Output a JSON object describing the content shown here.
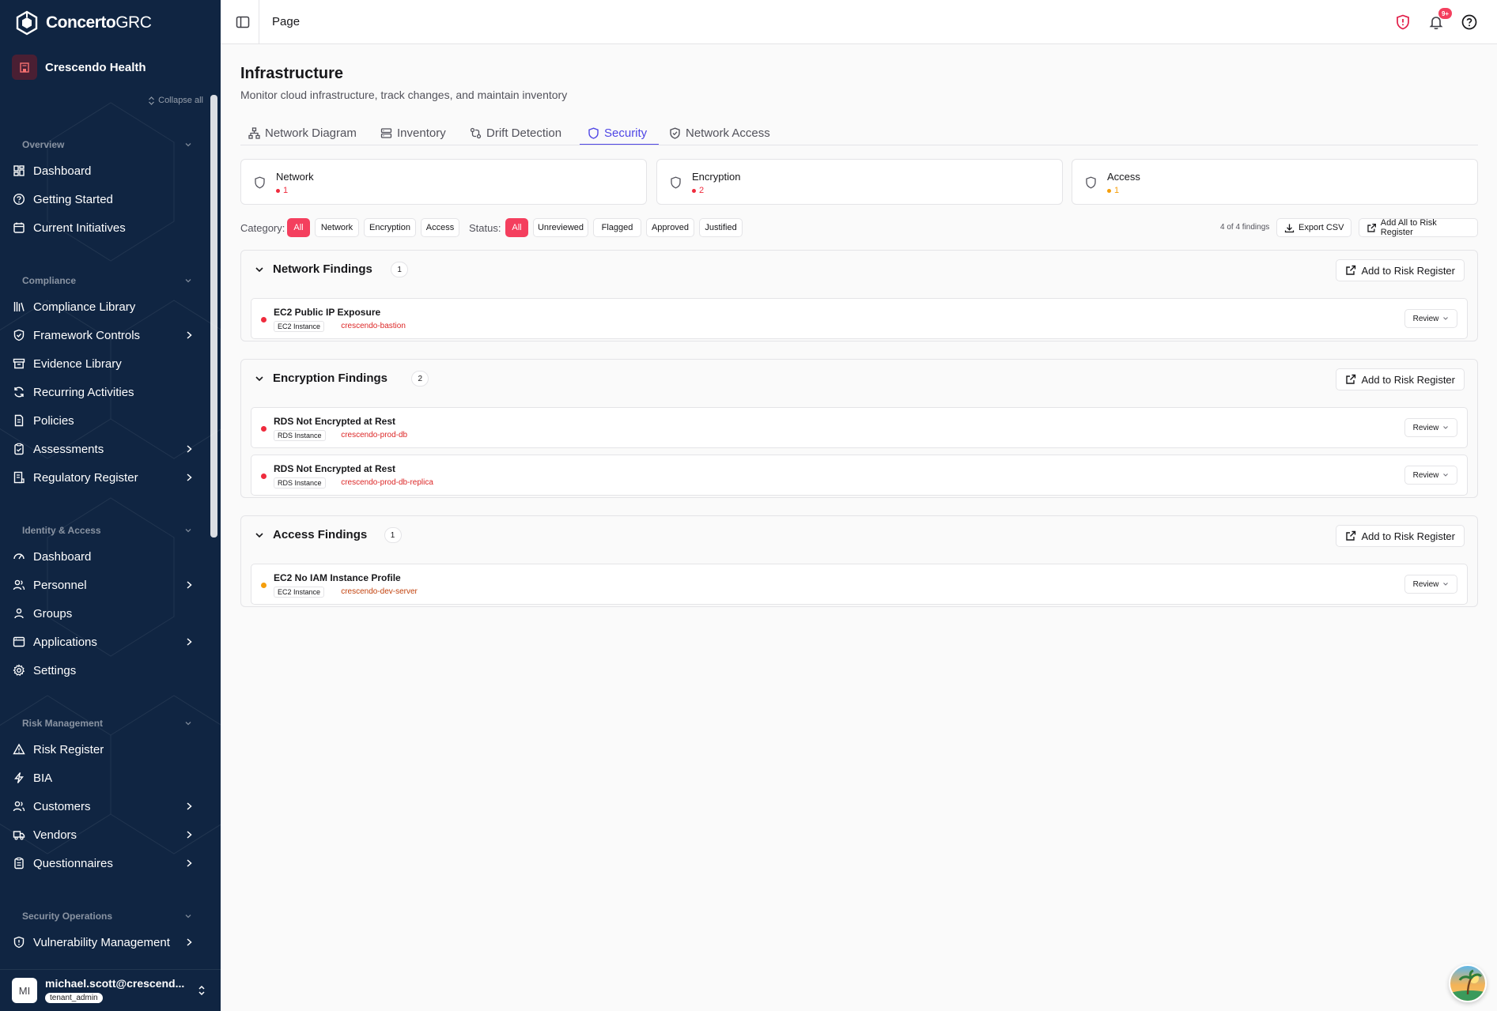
{
  "brand": {
    "name_bold": "Concerto",
    "name_light": "GRC"
  },
  "tenant": {
    "name": "Crescendo Health"
  },
  "sidebar": {
    "collapse_all": "Collapse all",
    "sections": [
      {
        "title": "Overview",
        "items": [
          {
            "label": "Dashboard",
            "icon": "grid-icon",
            "chevron": false
          },
          {
            "label": "Getting Started",
            "icon": "help-circle-icon",
            "chevron": false
          },
          {
            "label": "Current Initiatives",
            "icon": "calendar-icon",
            "chevron": false
          }
        ]
      },
      {
        "title": "Compliance",
        "items": [
          {
            "label": "Compliance Library",
            "icon": "library-icon",
            "chevron": false
          },
          {
            "label": "Framework Controls",
            "icon": "shield-check-icon",
            "chevron": true
          },
          {
            "label": "Evidence Library",
            "icon": "archive-icon",
            "chevron": false
          },
          {
            "label": "Recurring Activities",
            "icon": "refresh-icon",
            "chevron": false
          },
          {
            "label": "Policies",
            "icon": "file-icon",
            "chevron": false
          },
          {
            "label": "Assessments",
            "icon": "clipboard-icon",
            "chevron": true
          },
          {
            "label": "Regulatory Register",
            "icon": "register-icon",
            "chevron": true
          }
        ]
      },
      {
        "title": "Identity & Access",
        "items": [
          {
            "label": "Dashboard",
            "icon": "gauge-icon",
            "chevron": false
          },
          {
            "label": "Personnel",
            "icon": "users-icon",
            "chevron": true
          },
          {
            "label": "Groups",
            "icon": "group-icon",
            "chevron": false
          },
          {
            "label": "Applications",
            "icon": "app-window-icon",
            "chevron": true
          },
          {
            "label": "Settings",
            "icon": "gear-icon",
            "chevron": false
          }
        ]
      },
      {
        "title": "Risk Management",
        "items": [
          {
            "label": "Risk Register",
            "icon": "warning-icon",
            "chevron": false
          },
          {
            "label": "BIA",
            "icon": "bolt-icon",
            "chevron": false
          },
          {
            "label": "Customers",
            "icon": "users-icon",
            "chevron": true
          },
          {
            "label": "Vendors",
            "icon": "truck-icon",
            "chevron": true
          },
          {
            "label": "Questionnaires",
            "icon": "clipboard-list-icon",
            "chevron": true
          }
        ]
      },
      {
        "title": "Security Operations",
        "items": [
          {
            "label": "Vulnerability Management",
            "icon": "shield-alert-icon",
            "chevron": true
          }
        ]
      }
    ]
  },
  "user": {
    "initials": "MI",
    "email": "michael.scott@crescend...",
    "role": "tenant_admin"
  },
  "topbar": {
    "breadcrumb": "Page",
    "notification_count": "9+"
  },
  "page": {
    "title": "Infrastructure",
    "subtitle": "Monitor cloud infrastructure, track changes, and maintain inventory"
  },
  "tabs": [
    {
      "label": "Network Diagram",
      "icon": "network-icon",
      "active": false
    },
    {
      "label": "Inventory",
      "icon": "server-icon",
      "active": false
    },
    {
      "label": "Drift Detection",
      "icon": "git-compare-icon",
      "active": false
    },
    {
      "label": "Security",
      "icon": "shield-icon",
      "active": true
    },
    {
      "label": "Network Access",
      "icon": "shield-check-icon",
      "active": false
    }
  ],
  "categories": [
    {
      "name": "Network",
      "count": "1",
      "color": "#ef2b3d"
    },
    {
      "name": "Encryption",
      "count": "2",
      "color": "#ef2b3d"
    },
    {
      "name": "Access",
      "count": "1",
      "color": "#f59e0b"
    }
  ],
  "filters": {
    "category_label": "Category:",
    "category_options": [
      "All",
      "Network",
      "Encryption",
      "Access"
    ],
    "status_label": "Status:",
    "status_options": [
      "All",
      "Unreviewed",
      "Flagged",
      "Approved",
      "Justified"
    ],
    "count_text": "4 of 4 findings",
    "export_label": "Export CSV",
    "add_all_label": "Add All to Risk Register"
  },
  "groups": [
    {
      "title": "Network Findings",
      "count": "1",
      "add_label": "Add to Risk Register",
      "findings": [
        {
          "title": "EC2 Public IP Exposure",
          "type": "EC2 Instance",
          "resource": "crescendo-bastion",
          "severity_color": "#ef2b3d",
          "resource_color": "#dc2626",
          "action": "Review"
        }
      ]
    },
    {
      "title": "Encryption Findings",
      "count": "2",
      "add_label": "Add to Risk Register",
      "findings": [
        {
          "title": "RDS Not Encrypted at Rest",
          "type": "RDS Instance",
          "resource": "crescendo-prod-db",
          "severity_color": "#ef2b3d",
          "resource_color": "#dc2626",
          "action": "Review"
        },
        {
          "title": "RDS Not Encrypted at Rest",
          "type": "RDS Instance",
          "resource": "crescendo-prod-db-replica",
          "severity_color": "#ef2b3d",
          "resource_color": "#dc2626",
          "action": "Review"
        }
      ]
    },
    {
      "title": "Access Findings",
      "count": "1",
      "add_label": "Add to Risk Register",
      "findings": [
        {
          "title": "EC2 No IAM Instance Profile",
          "type": "EC2 Instance",
          "resource": "crescendo-dev-server",
          "severity_color": "#f59e0b",
          "resource_color": "#c2410c",
          "action": "Review"
        }
      ]
    }
  ]
}
